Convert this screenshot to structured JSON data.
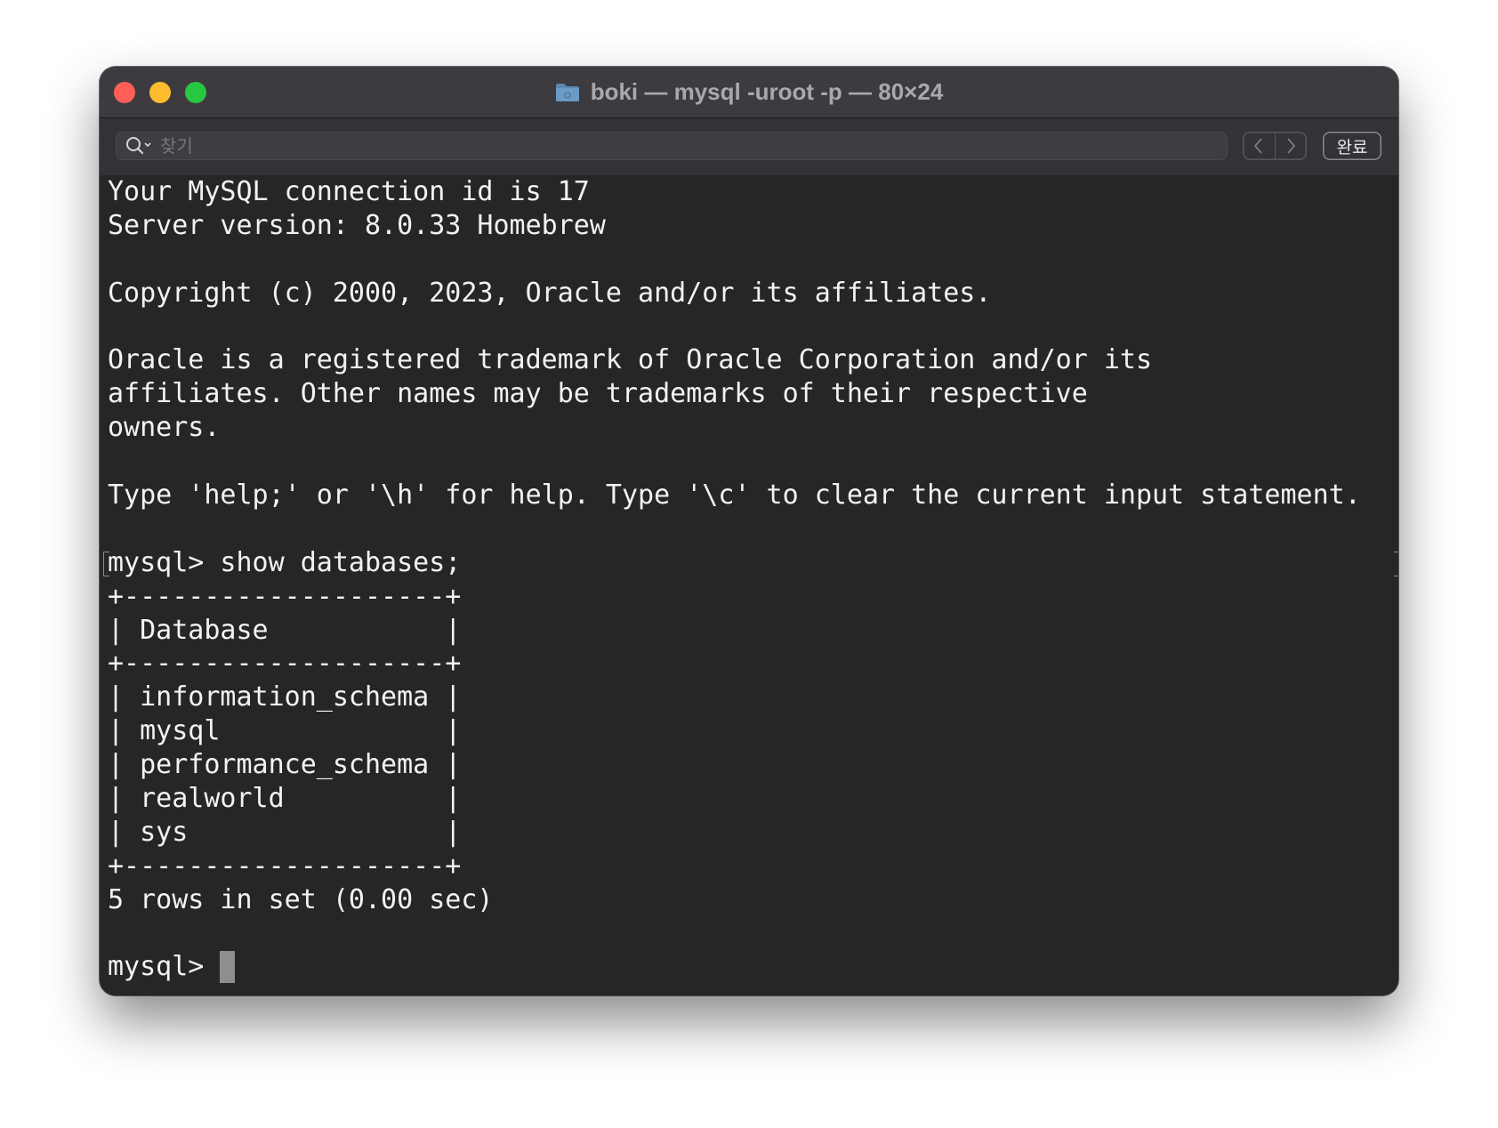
{
  "window": {
    "title": "boki — mysql -uroot -p — 80×24"
  },
  "findbar": {
    "placeholder": "찾기",
    "done_label": "완료"
  },
  "terminal": {
    "lines": [
      "Your MySQL connection id is 17",
      "Server version: 8.0.33 Homebrew",
      "",
      "Copyright (c) 2000, 2023, Oracle and/or its affiliates.",
      "",
      "Oracle is a registered trademark of Oracle Corporation and/or its",
      "affiliates. Other names may be trademarks of their respective",
      "owners.",
      "",
      "Type 'help;' or '\\h' for help. Type '\\c' to clear the current input statement.",
      "",
      "mysql> show databases;",
      "+--------------------+",
      "| Database           |",
      "+--------------------+",
      "| information_schema |",
      "| mysql              |",
      "| performance_schema |",
      "| realworld          |",
      "| sys                |",
      "+--------------------+",
      "5 rows in set (0.00 sec)",
      "",
      "mysql>"
    ]
  },
  "colors": {
    "terminal_bg": "#262626",
    "terminal_fg": "#f2f2f2",
    "titlebar_bg": "#3d3b40",
    "close": "#ff5f57",
    "minimize": "#febc2e",
    "zoom": "#28c840"
  }
}
